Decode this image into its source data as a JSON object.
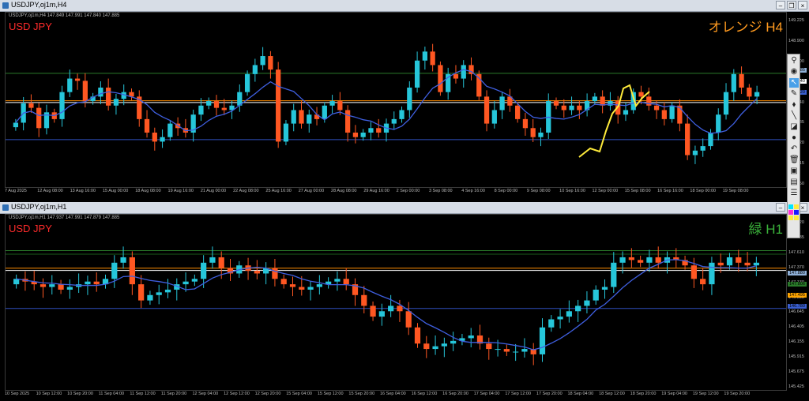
{
  "top": {
    "window_title": "USDJPY,oj1m,H4",
    "info": "USDJPY,oj1m,H4  147.849  147.991  147.840  147.885",
    "symbol_label": "USD JPY",
    "big_label": "オレンジ H4",
    "big_color": "#ff9a1f",
    "price_labels": [
      "149.225",
      "148.900",
      "148.200",
      "147.885",
      "147.640",
      "147.185",
      "146.920",
      "146.615",
      "146.350"
    ],
    "price_tags": [
      {
        "text": "147.885",
        "color": "#8fb0d8"
      },
      {
        "text": "147.640",
        "color": "#ffffff"
      },
      {
        "text": "146.920",
        "color": "#3a5fd0"
      }
    ],
    "xlabels": [
      "7 Aug 2025",
      "12 Aug 08:00",
      "13 Aug 16:00",
      "15 Aug 00:00",
      "18 Aug 08:00",
      "19 Aug 16:00",
      "21 Aug 00:00",
      "22 Aug 08:00",
      "25 Aug 16:00",
      "27 Aug 00:00",
      "28 Aug 08:00",
      "29 Aug 16:00",
      "2 Sep 00:00",
      "3 Sep 08:00",
      "4 Sep 16:00",
      "8 Sep 00:00",
      "9 Sep 08:00",
      "10 Sep 16:00",
      "12 Sep 00:00",
      "15 Sep 08:00",
      "16 Sep 16:00",
      "18 Sep 00:00",
      "19 Sep 08:00"
    ],
    "hlines": [
      {
        "color": "#2a7a2a",
        "y": 0.348
      },
      {
        "color": "#ff8c00",
        "y": 0.505
      },
      {
        "color": "#ffffff",
        "y": 0.515
      },
      {
        "color": "#2f4fbf",
        "y": 0.728
      }
    ],
    "close": [
      147.22,
      147.65,
      147.55,
      147.1,
      147.45,
      147.3,
      147.9,
      148.2,
      148.15,
      147.7,
      147.8,
      148.0,
      147.6,
      147.75,
      147.9,
      147.8,
      147.3,
      147.0,
      146.8,
      146.9,
      147.2,
      147.1,
      147.0,
      147.4,
      147.6,
      147.7,
      147.55,
      147.5,
      147.6,
      147.9,
      148.3,
      148.5,
      148.7,
      148.4,
      146.8,
      147.2,
      147.5,
      147.2,
      147.4,
      147.3,
      147.6,
      147.7,
      147.5,
      147.0,
      146.9,
      147.0,
      147.1,
      147.0,
      147.2,
      147.3,
      147.5,
      148.0,
      148.6,
      148.8,
      148.5,
      147.9,
      148.3,
      148.2,
      148.5,
      148.3,
      147.8,
      147.2,
      147.5,
      147.8,
      147.6,
      147.3,
      147.1,
      146.9,
      147.0,
      147.7,
      147.6,
      147.5,
      147.6,
      147.5,
      147.7,
      147.8,
      147.6,
      147.7,
      147.4,
      147.5,
      147.9,
      147.8,
      147.6,
      147.5,
      147.3,
      147.6,
      147.2,
      146.5,
      146.6,
      146.7,
      147.0,
      147.4,
      147.9,
      148.3,
      148.0,
      147.8,
      147.9
    ]
  },
  "bottom": {
    "window_title": "USDJPY,oj1m,H1",
    "info": "USDJPY,oj1m,H1  147.937  147.991  147.879  147.885",
    "symbol_label": "USD JPY",
    "big_label": "緑 H1",
    "big_color": "#3ab13a",
    "price_labels": [
      "148.120",
      "147.885",
      "147.610",
      "147.370",
      "147.130",
      "146.885",
      "146.645",
      "146.405",
      "146.155",
      "145.915",
      "145.675",
      "145.425"
    ],
    "price_tags": [
      {
        "text": "147.880",
        "color": "#8fb0d8"
      },
      {
        "text": "147.806",
        "color": "#2a7a2a"
      },
      {
        "text": "147.495",
        "color": "#ffa500"
      },
      {
        "text": "146.780",
        "color": "#3a5fd0"
      }
    ],
    "xlabels": [
      "10 Sep 2025",
      "10 Sep 12:00",
      "10 Sep 20:00",
      "11 Sep 04:00",
      "11 Sep 12:00",
      "11 Sep 20:00",
      "12 Sep 04:00",
      "12 Sep 12:00",
      "12 Sep 20:00",
      "15 Sep 04:00",
      "15 Sep 12:00",
      "15 Sep 20:00",
      "16 Sep 04:00",
      "16 Sep 12:00",
      "16 Sep 20:00",
      "17 Sep 04:00",
      "17 Sep 12:00",
      "17 Sep 20:00",
      "18 Sep 04:00",
      "18 Sep 12:00",
      "18 Sep 20:00",
      "19 Sep 04:00",
      "19 Sep 12:00",
      "19 Sep 20:00"
    ],
    "hlines": [
      {
        "color": "#2a7a2a",
        "y": 0.205
      },
      {
        "color": "#1a5a1a",
        "y": 0.225
      },
      {
        "color": "#ff8c00",
        "y": 0.305
      },
      {
        "color": "#ffffff",
        "y": 0.318
      },
      {
        "color": "#2f4fbf",
        "y": 0.535
      }
    ],
    "close": [
      147.6,
      147.55,
      147.5,
      147.45,
      147.5,
      147.4,
      147.45,
      147.5,
      147.55,
      147.5,
      147.6,
      147.9,
      148.0,
      147.5,
      147.2,
      147.3,
      147.35,
      147.4,
      147.5,
      147.55,
      147.6,
      147.9,
      148.0,
      147.8,
      147.7,
      147.85,
      147.75,
      147.7,
      147.8,
      147.6,
      147.5,
      147.45,
      147.4,
      147.45,
      147.5,
      147.55,
      147.6,
      147.5,
      147.3,
      147.1,
      146.9,
      147.0,
      147.1,
      147.0,
      146.7,
      146.4,
      146.3,
      146.35,
      146.4,
      146.45,
      146.5,
      146.55,
      146.4,
      146.3,
      146.3,
      146.25,
      146.25,
      146.3,
      146.2,
      146.7,
      146.85,
      146.9,
      147.0,
      147.1,
      147.2,
      147.4,
      147.45,
      147.9,
      148.0,
      147.95,
      147.9,
      148.0,
      147.9,
      148.0,
      147.95,
      147.85,
      147.6,
      147.5,
      147.9,
      147.85,
      148.0,
      147.9,
      147.85,
      147.9
    ]
  },
  "toolbar": {
    "icons": [
      "pin-icon",
      "eye-icon",
      "cursor-icon",
      "ruler-icon",
      "tag-icon",
      "line-tool-icon",
      "eraser-icon",
      "dot-icon",
      "undo-icon",
      "trash-icon",
      "bus-icon",
      "screenshot-icon",
      "list-icon"
    ],
    "glyphs": [
      "⚲",
      "◉",
      "↖",
      "✎",
      "⬧",
      "╲",
      "◪",
      "●",
      "↶",
      "🗑",
      "▣",
      "▤",
      "☰"
    ]
  }
}
